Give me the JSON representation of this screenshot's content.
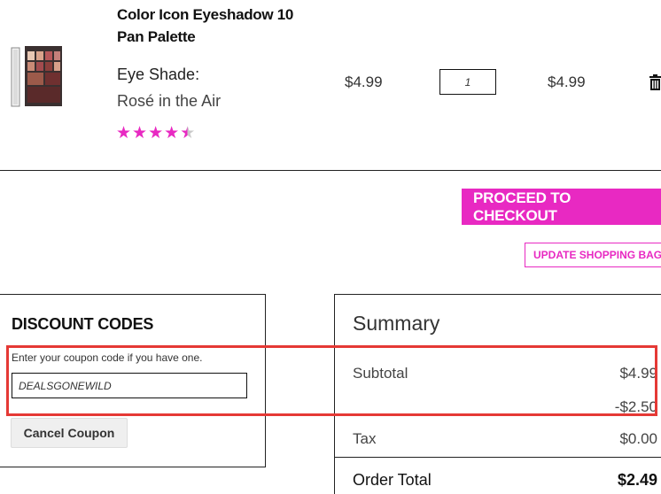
{
  "product": {
    "name": "Color Icon Eyeshadow 10 Pan Palette",
    "option_label": "Eye Shade:",
    "option_value": "Rosé in the Air",
    "rating": 4.5,
    "price": "$4.99",
    "quantity": "1",
    "subtotal": "$4.99"
  },
  "actions": {
    "checkout_label": "PROCEED TO CHECKOUT",
    "update_label": "UPDATE SHOPPING BAG"
  },
  "discount": {
    "title": "DISCOUNT CODES",
    "hint": "Enter your coupon code if you have one.",
    "code": "DEALSGONEWILD",
    "cancel_label": "Cancel Coupon"
  },
  "summary": {
    "title": "Summary",
    "subtotal_label": "Subtotal",
    "subtotal_value": "$4.99",
    "discount_value": "-$2.50",
    "tax_label": "Tax",
    "tax_value": "$0.00",
    "order_total_label": "Order Total",
    "order_total_value": "$2.49"
  },
  "colors": {
    "accent": "#e829c2",
    "highlight": "#e53935"
  }
}
